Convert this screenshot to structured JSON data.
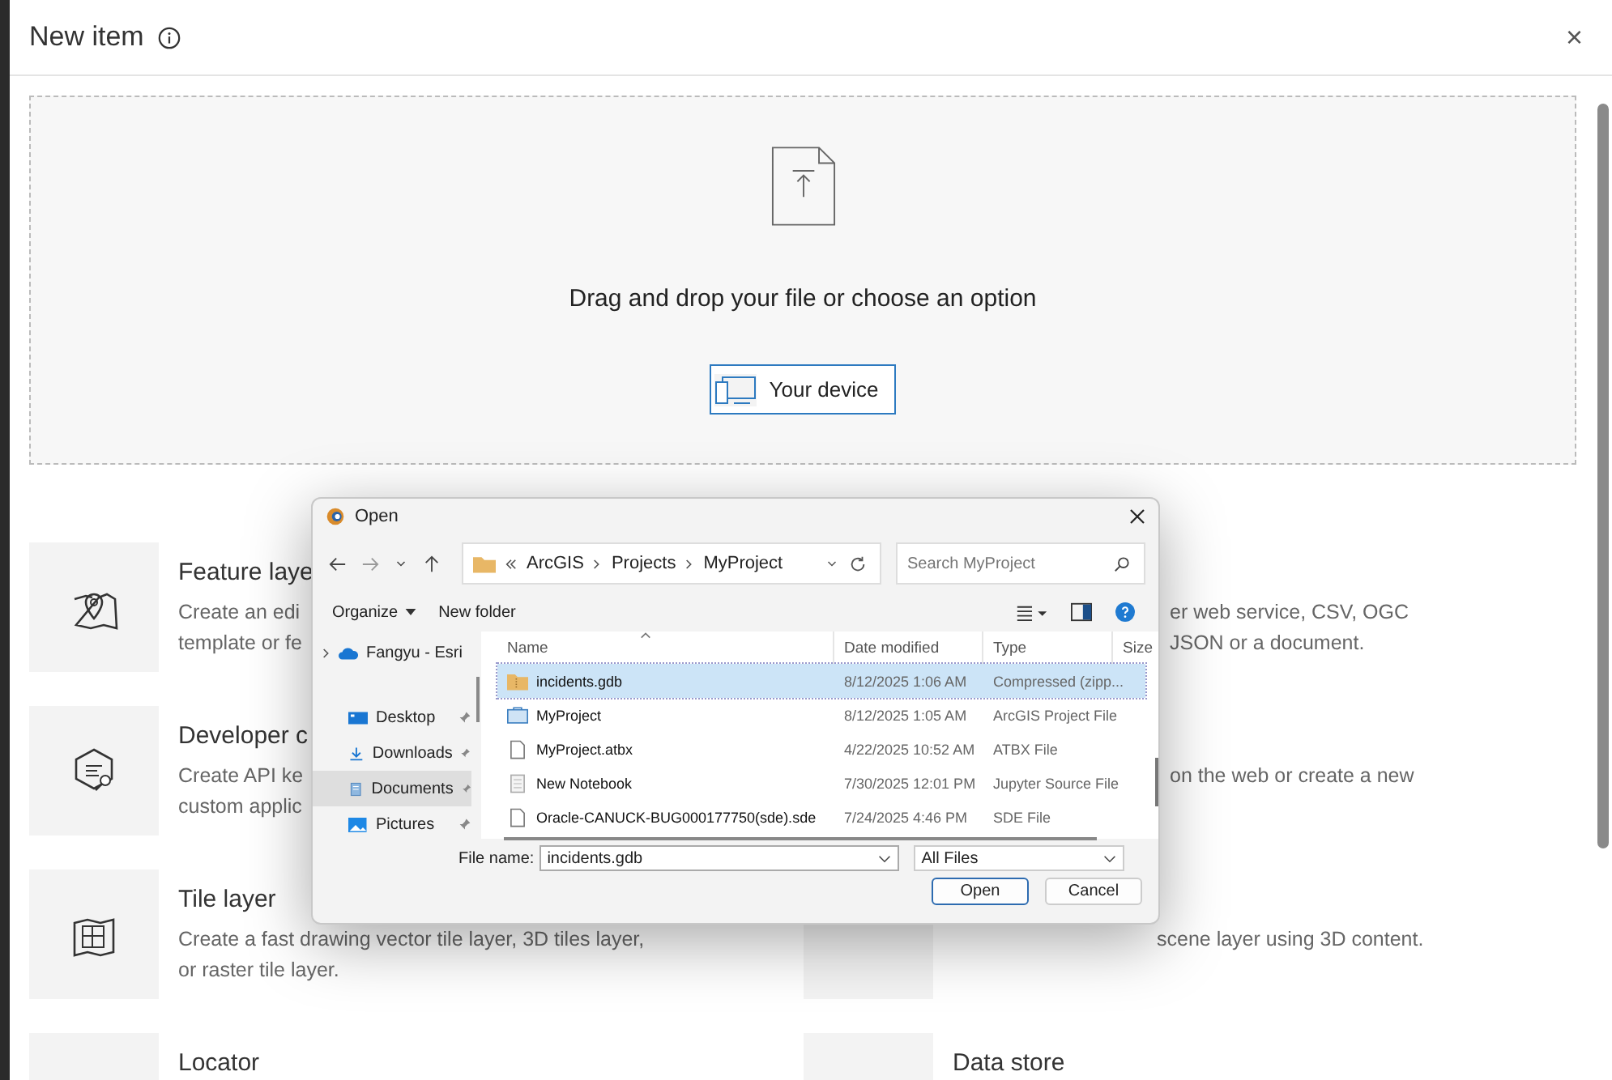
{
  "panel": {
    "title": "New item",
    "close": "×"
  },
  "dropzone": {
    "prompt": "Drag and drop your file or choose an option",
    "button": "Your device"
  },
  "cards_left": [
    {
      "title": "Feature laye",
      "lines": [
        "Create an edi",
        "template or fe"
      ]
    },
    {
      "title": "Developer c",
      "lines": [
        "Create API ke",
        "custom applic"
      ]
    },
    {
      "title": "Tile layer",
      "lines": [
        "Create a fast drawing vector tile layer, 3D tiles layer,",
        "or raster tile layer."
      ]
    },
    {
      "title": "Locator"
    }
  ],
  "cards_right": [
    {
      "covered": true,
      "lines": [
        "er web service, CSV, OGC",
        "JSON or a document."
      ]
    },
    {
      "covered": true,
      "lines": [
        "on the web or create a new"
      ]
    },
    {
      "covered": true,
      "lines": [
        "scene layer using 3D content."
      ]
    },
    {
      "covered": false,
      "title": "Data store"
    }
  ],
  "dialog": {
    "title": "Open",
    "path": [
      "ArcGIS",
      "Projects",
      "MyProject"
    ],
    "search_placeholder": "Search MyProject",
    "organize": "Organize",
    "new_folder": "New folder",
    "sidebar": [
      {
        "label": "Fangyu - Esri",
        "kind": "cloud",
        "selected": false
      },
      {
        "label": "Desktop",
        "kind": "desktop",
        "selected": false
      },
      {
        "label": "Downloads",
        "kind": "download",
        "selected": false
      },
      {
        "label": "Documents",
        "kind": "documents",
        "selected": true
      },
      {
        "label": "Pictures",
        "kind": "pictures",
        "selected": false
      }
    ],
    "columns": [
      "Name",
      "Date modified",
      "Type",
      "Size"
    ],
    "files": [
      {
        "name": "incidents.gdb",
        "date": "8/12/2025 1:06 AM",
        "type": "Compressed (zipp...",
        "kind": "zip",
        "selected": true
      },
      {
        "name": "MyProject",
        "date": "8/12/2025 1:05 AM",
        "type": "ArcGIS Project File",
        "kind": "project",
        "selected": false
      },
      {
        "name": "MyProject.atbx",
        "date": "4/22/2025 10:52 AM",
        "type": "ATBX File",
        "kind": "file",
        "selected": false
      },
      {
        "name": "New Notebook",
        "date": "7/30/2025 12:01 PM",
        "type": "Jupyter Source File",
        "kind": "notebook",
        "selected": false
      },
      {
        "name": "Oracle-CANUCK-BUG000177750(sde).sde",
        "date": "7/24/2025 4:46 PM",
        "type": "SDE File",
        "kind": "file",
        "selected": false
      }
    ],
    "file_name_label": "File name:",
    "file_name": "incidents.gdb",
    "file_type": "All Files",
    "open": "Open",
    "cancel": "Cancel"
  }
}
